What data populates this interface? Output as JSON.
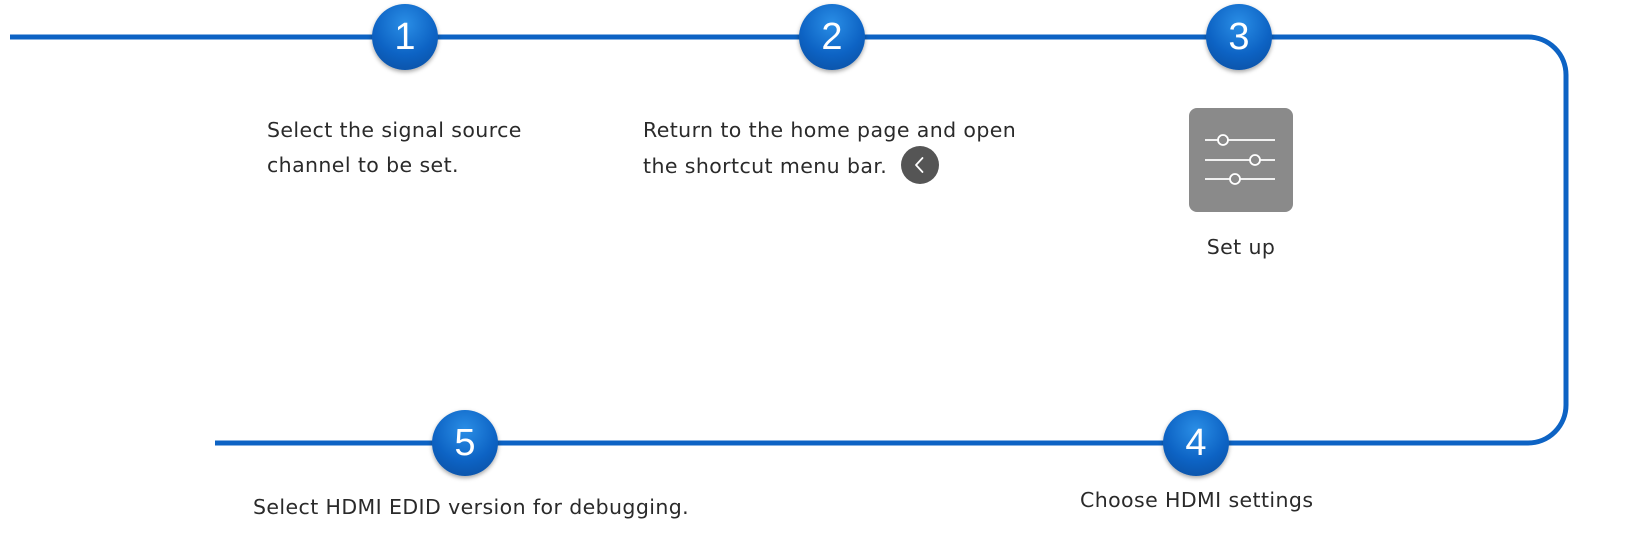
{
  "steps": [
    {
      "number": "1",
      "lines": [
        "Select the signal source",
        "channel to be set."
      ]
    },
    {
      "number": "2",
      "lines": [
        "Return to the home page and open",
        "the shortcut menu bar."
      ],
      "button_icon": "chevron-left-icon"
    },
    {
      "number": "3",
      "tile_icon": "sliders-icon",
      "label": "Set up"
    },
    {
      "number": "4",
      "lines": [
        "Choose HDMI settings"
      ]
    },
    {
      "number": "5",
      "lines": [
        "Select HDMI EDID version for debugging."
      ]
    }
  ],
  "colors": {
    "line": "#0d63c4",
    "badge": "#1272d4",
    "tile": "#8a8a8a",
    "button": "#555555",
    "text": "#2a2a2a"
  }
}
